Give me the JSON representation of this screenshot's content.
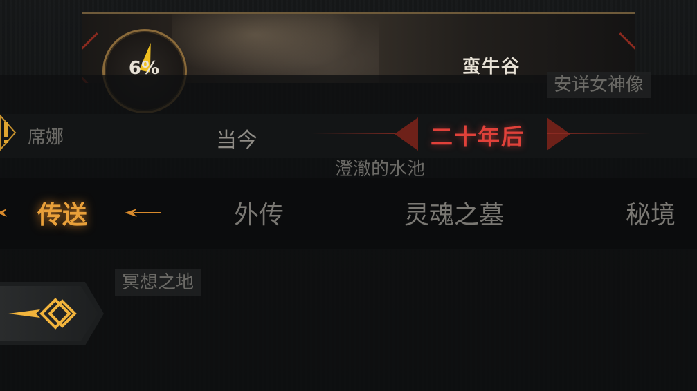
{
  "map": {
    "progress_percent": "6%",
    "region_name": "蛮牛谷",
    "waypoints": {
      "statue": "安详女神像",
      "npc": "席娜",
      "pool": "澄澈的水池",
      "meditation": "冥想之地"
    }
  },
  "timeline": {
    "current": "当今",
    "future": "二十年后",
    "selected": "future"
  },
  "tabs": {
    "teleport": "传送",
    "side_story": "外传",
    "soul_tomb": "灵魂之墓",
    "secret_realm": "秘境",
    "active": "teleport"
  },
  "colors": {
    "active_tab": "#e9a03a",
    "timeline_active": "#e0413a",
    "progress_fill": "#f0c020"
  },
  "icons": {
    "back": "back-diamond-arrow-icon",
    "npc_alert": "exclamation-icon"
  }
}
